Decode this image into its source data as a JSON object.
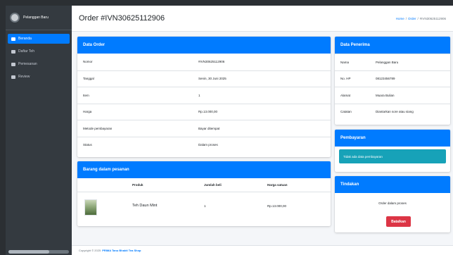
{
  "sidebar": {
    "user_name": "Pelanggan Baru",
    "items": [
      {
        "label": "Beranda",
        "icon": "home-icon",
        "active": true
      },
      {
        "label": "Daftar Teh",
        "icon": "list-icon",
        "active": false
      },
      {
        "label": "Pemesanan",
        "icon": "cart-icon",
        "active": false
      },
      {
        "label": "Review",
        "icon": "star-icon",
        "active": false
      }
    ]
  },
  "header": {
    "title": "Order #IVN30625112906",
    "breadcrumb": [
      "Home",
      "Order",
      "#IVN30625112906"
    ]
  },
  "order": {
    "header": "Data Order",
    "rows": [
      {
        "label": "Nomor",
        "value": "#IVN30625112906"
      },
      {
        "label": "Tanggal",
        "value": "Senin, 30 Juni 2025"
      },
      {
        "label": "Item",
        "value": "1"
      },
      {
        "label": "Harga",
        "value": "Rp.13.000,00"
      },
      {
        "label": "Metode pembayaran",
        "value": "Bayar ditempat"
      },
      {
        "label": "Status",
        "value": "Dalam proses"
      }
    ]
  },
  "items": {
    "header": "Barang dalam pesanan",
    "columns": [
      "Produk",
      "Jumlah beli",
      "Harga satuan"
    ],
    "rows": [
      {
        "name": "Teh Daun Mint",
        "qty": "1",
        "price": "Rp.13.000,00"
      }
    ]
  },
  "recipient": {
    "header": "Data Penerima",
    "rows": [
      {
        "label": "Nama",
        "value": "Pelanggan Baru"
      },
      {
        "label": "No. HP",
        "value": "08123456789"
      },
      {
        "label": "Alamat",
        "value": "Muara Bulian"
      },
      {
        "label": "Catatan",
        "value": "Diantarkan sore atau siang"
      }
    ]
  },
  "payment": {
    "header": "Pembayaran",
    "notice": "Tidak ada data pembayaran"
  },
  "actions": {
    "header": "Tindakan",
    "status_text": "Order dalam proses",
    "cancel_label": "Batalkan"
  },
  "footer": {
    "text": "Copyright © 2025",
    "link": "PRIMA Tanu Bhakti Tea Shop"
  }
}
